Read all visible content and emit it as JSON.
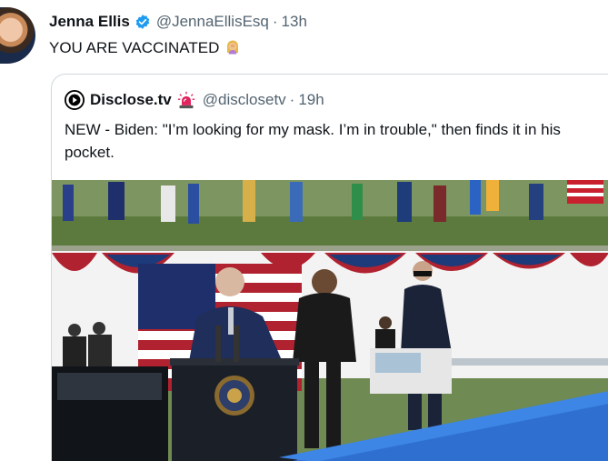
{
  "tweet": {
    "author_name": "Jenna Ellis",
    "author_handle": "@JennaEllisEsq",
    "separator": "·",
    "timestamp": "13h",
    "text": "YOU ARE VACCINATED",
    "verified_color": "#1d9bf0"
  },
  "quoted": {
    "author_name": "Disclose.tv",
    "author_handle": "@disclosetv",
    "separator": "·",
    "timestamp": "19h",
    "text": "NEW - Biden: \"I’m looking for my mask. I’m in trouble,\" then finds it in his pocket."
  },
  "icons": {
    "verified": "verified-badge-icon",
    "face_palm": "woman-facepalming-emoji",
    "siren": "police-light-emoji",
    "quoted_avatar": "disclose-logo-icon"
  }
}
